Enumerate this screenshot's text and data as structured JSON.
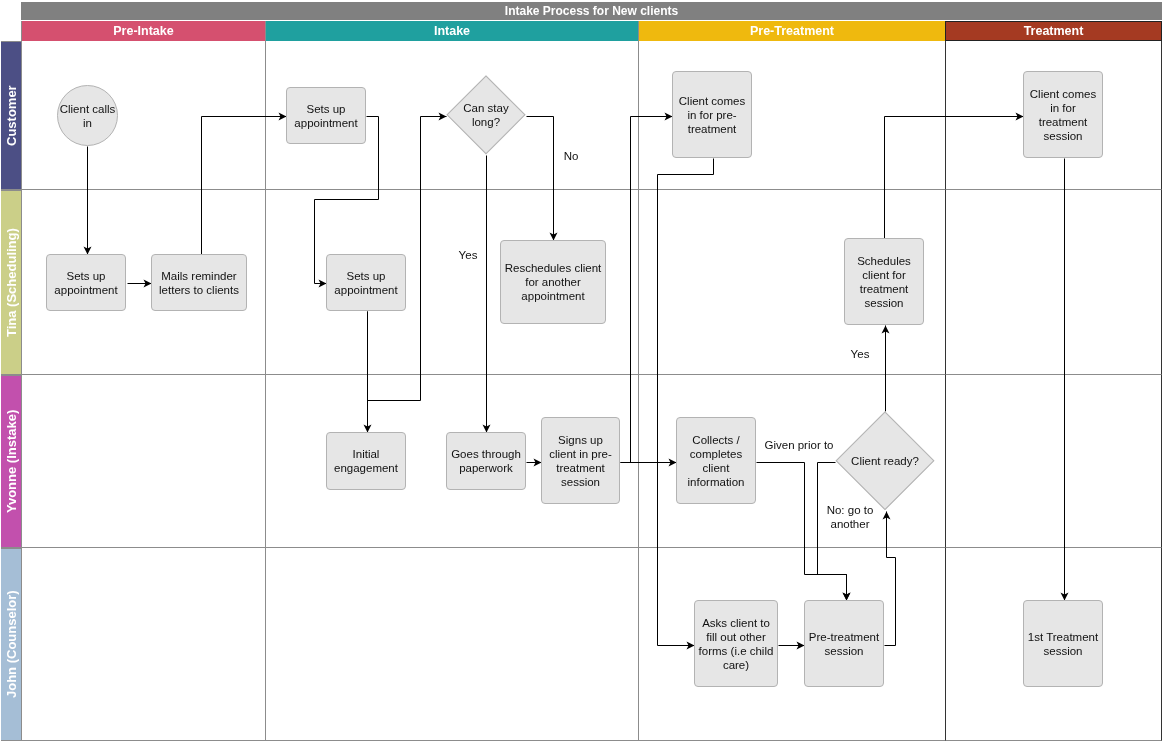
{
  "diagram": {
    "title": "Intake Process for New clients",
    "phases": [
      {
        "label": "Pre-Intake",
        "color": "#d5506f"
      },
      {
        "label": "Intake",
        "color": "#1fa09f"
      },
      {
        "label": "Pre-Treatment",
        "color": "#efb90e"
      },
      {
        "label": "Treatment",
        "color": "#a53a22"
      }
    ],
    "lanes": [
      {
        "label": "Customer",
        "color": "#4c4f85"
      },
      {
        "label": "Tina (Scheduling)",
        "color": "#cbcf88"
      },
      {
        "label": "Yvonne (Instake)",
        "color": "#c250ad"
      },
      {
        "label": "John (Counselor)",
        "color": "#a5bed6"
      }
    ],
    "nodes": [
      {
        "kind": "start",
        "text": "Client calls in"
      },
      {
        "kind": "process",
        "text": "Sets up appointment"
      },
      {
        "kind": "decision",
        "text": "Can stay long?"
      },
      {
        "kind": "process",
        "text": "Client comes in for pre-treatment"
      },
      {
        "kind": "process",
        "text": "Client comes in for treatment session"
      },
      {
        "kind": "process",
        "text": "Sets up appointment"
      },
      {
        "kind": "process",
        "text": "Mails reminder letters to clients"
      },
      {
        "kind": "process",
        "text": "Sets up appointment"
      },
      {
        "kind": "process",
        "text": "Reschedules client for another appointment"
      },
      {
        "kind": "process",
        "text": "Schedules client for treatment session"
      },
      {
        "kind": "process",
        "text": "Initial engagement"
      },
      {
        "kind": "process",
        "text": "Goes through paperwork"
      },
      {
        "kind": "process",
        "text": "Signs up client in pre-treatment session"
      },
      {
        "kind": "process",
        "text": "Collects / completes client information"
      },
      {
        "kind": "decision",
        "text": "Client ready?"
      },
      {
        "kind": "process",
        "text": "Asks client to fill out other forms (i.e child care)"
      },
      {
        "kind": "process",
        "text": "Pre-treatment session"
      },
      {
        "kind": "process",
        "text": "1st Treatment session"
      }
    ],
    "edge_labels": [
      "No",
      "Yes",
      "Yes",
      "Given prior to",
      "No: go to another"
    ]
  }
}
